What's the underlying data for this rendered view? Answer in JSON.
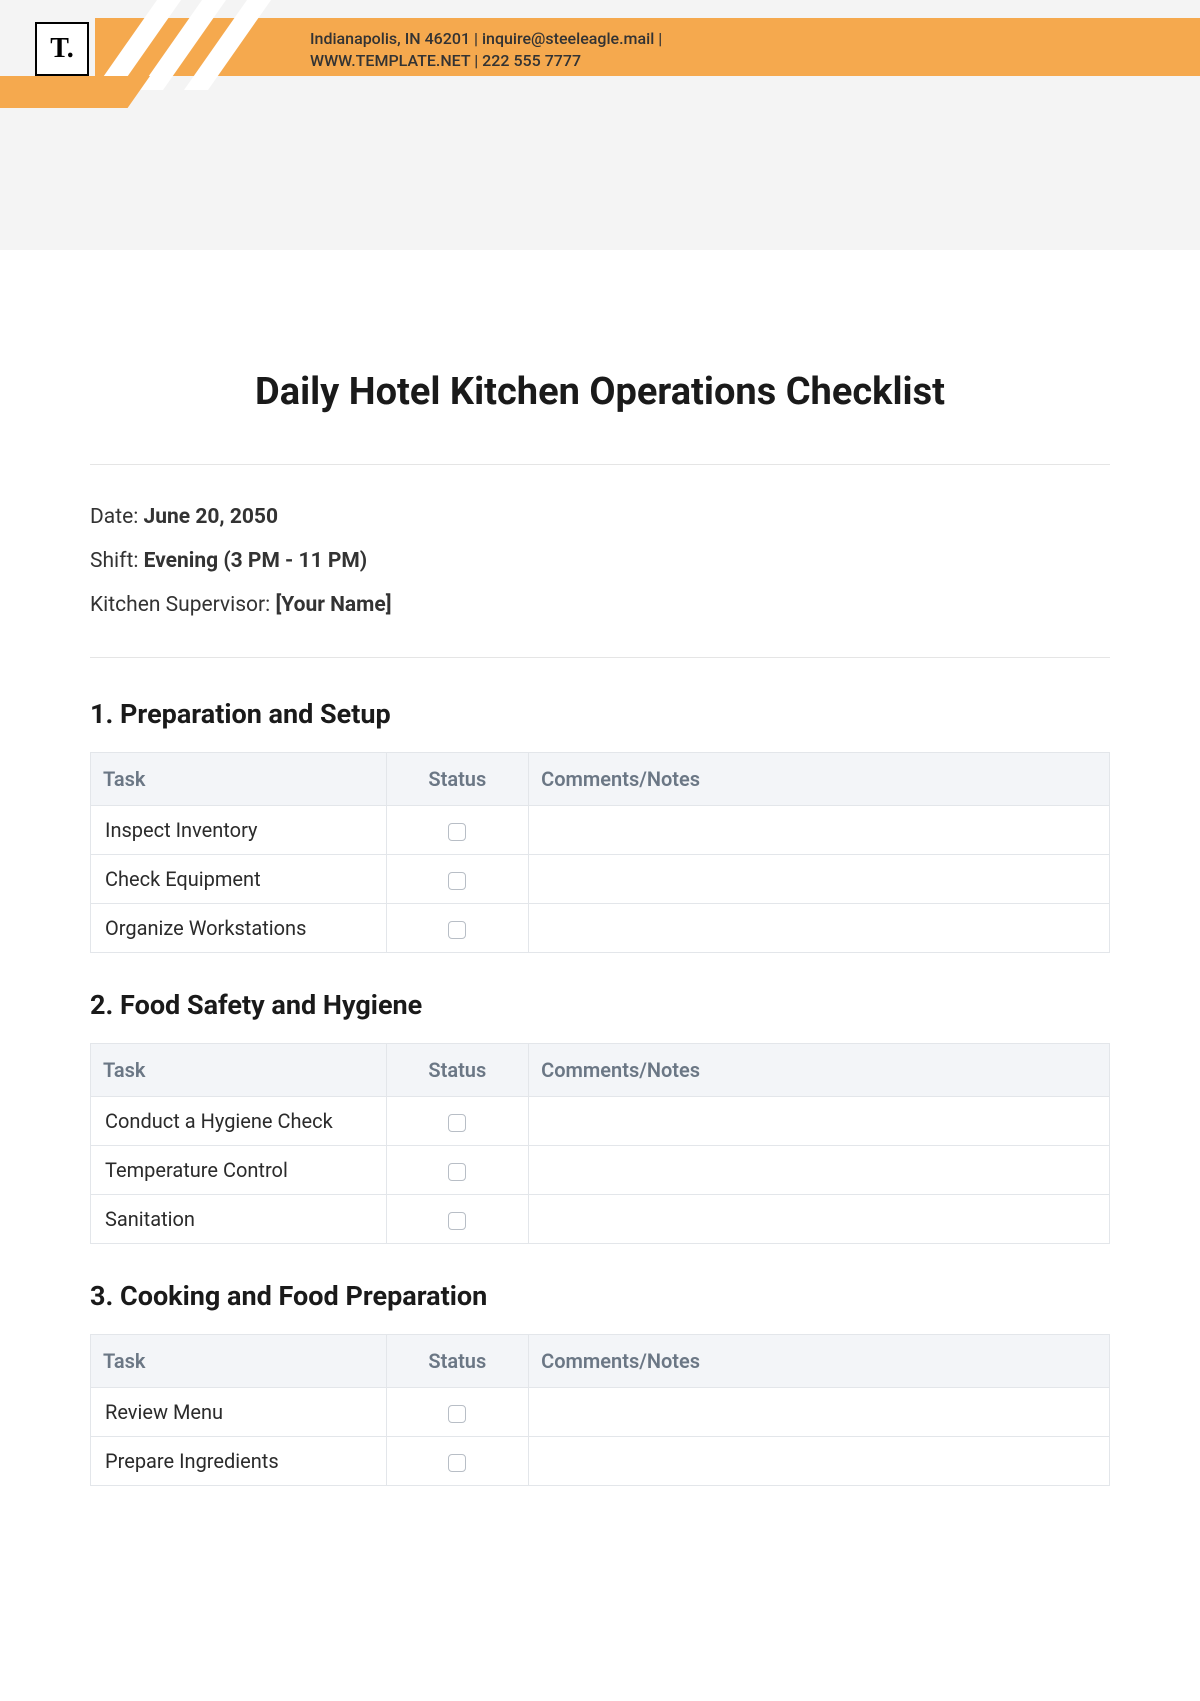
{
  "logo": "T.",
  "header": {
    "line1": "Indianapolis, IN 46201 | inquire@steeleagle.mail |",
    "line2": "WWW.TEMPLATE.NET | 222 555 7777"
  },
  "title": "Daily Hotel Kitchen Operations Checklist",
  "meta": {
    "date_label": "Date: ",
    "date_value": "June 20, 2050",
    "shift_label": "Shift: ",
    "shift_value": "Evening (3 PM - 11 PM)",
    "supervisor_label": "Kitchen Supervisor: ",
    "supervisor_value": "[Your Name]"
  },
  "columns": {
    "task": "Task",
    "status": "Status",
    "notes": "Comments/Notes"
  },
  "sections": [
    {
      "title": "1. Preparation and Setup",
      "rows": [
        "Inspect Inventory",
        "Check Equipment",
        "Organize Workstations"
      ]
    },
    {
      "title": "2. Food Safety and Hygiene",
      "rows": [
        "Conduct a Hygiene Check",
        "Temperature Control",
        "Sanitation"
      ]
    },
    {
      "title": "3. Cooking and Food Preparation",
      "rows": [
        "Review Menu",
        "Prepare Ingredients"
      ]
    }
  ]
}
